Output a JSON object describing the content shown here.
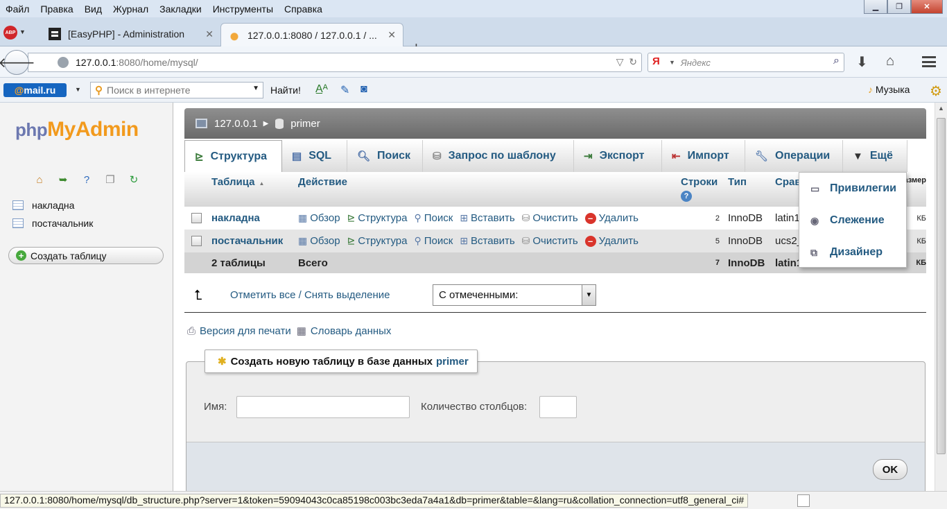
{
  "menubar": {
    "items": [
      "Файл",
      "Правка",
      "Вид",
      "Журнал",
      "Закладки",
      "Инструменты",
      "Справка"
    ],
    "window_controls": [
      "minimize-icon",
      "restore-icon",
      "close-icon"
    ]
  },
  "tabs": [
    {
      "title": "[EasyPHP] - Administration",
      "favicon": "easyphp-icon"
    },
    {
      "title": "127.0.0.1:8080 / 127.0.0.1 / ...",
      "favicon": "phpmyadmin-icon"
    }
  ],
  "navbar": {
    "url_host": "127.0.0.1",
    "url_rest": ":8080/home/mysql/",
    "search_placeholder": "Яндекс",
    "search_engine_glyph": "Я"
  },
  "mailbar": {
    "logo_at": "@",
    "logo_text": "mail.ru",
    "search_placeholder": "Поиск в интернете",
    "find_label": "Найти!",
    "music_label": "Музыка"
  },
  "sidebar": {
    "logo_php": "php",
    "logo_my": "My",
    "logo_admin": "Admin",
    "tables": [
      "накладна",
      "постачальник"
    ],
    "create_table": "Создать таблицу"
  },
  "main": {
    "breadcrumb": {
      "server": "127.0.0.1",
      "database": "primer"
    },
    "tabs": [
      {
        "label": "Структура",
        "icon": "structure-icon",
        "active": true
      },
      {
        "label": "SQL",
        "icon": "sql-icon",
        "active": false
      },
      {
        "label": "Поиск",
        "icon": "search-icon",
        "active": false
      },
      {
        "label": "Запрос по шаблону",
        "icon": "query-icon",
        "active": false
      },
      {
        "label": "Экспорт",
        "icon": "export-icon",
        "active": false
      },
      {
        "label": "Импорт",
        "icon": "import-icon",
        "active": false
      },
      {
        "label": "Операции",
        "icon": "wrench-icon",
        "active": false
      },
      {
        "label": "Ещё",
        "icon": "chevron-down-icon",
        "active": false
      }
    ],
    "more_menu": [
      "Привилегии",
      "Слежение",
      "Дизайнер"
    ],
    "table": {
      "headers": {
        "table": "Таблица",
        "action": "Действие",
        "rows": "Строки",
        "type": "Тип",
        "collation": "Сравнение",
        "size": "Размер"
      },
      "actions": [
        "Обзор",
        "Структура",
        "Поиск",
        "Вставить",
        "Очистить",
        "Удалить"
      ],
      "rows": [
        {
          "name": "накладна",
          "rows": "2",
          "type": "InnoDB",
          "collation": "latin1_swedish_ci",
          "size": "КБ"
        },
        {
          "name": "постачальник",
          "rows": "5",
          "type": "InnoDB",
          "collation": "ucs2_general_ci",
          "size": "КБ"
        }
      ],
      "total": {
        "label": "2 таблицы",
        "action": "Всего",
        "rows": "7",
        "type": "InnoDB",
        "collation": "latin1_swedish_ci",
        "size": "КБ"
      }
    },
    "check_all": "Отметить все / Снять выделение",
    "with_selected": "С отмеченными:",
    "print_view": "Версия для печати",
    "data_dictionary": "Словарь данных",
    "create_new": {
      "legend": "Создать новую таблицу в базе данных",
      "dbname": "primer",
      "name_label": "Имя:",
      "name_value": "",
      "columns_label": "Количество столбцов:",
      "columns_value": "",
      "ok_label": "OK"
    }
  },
  "statusbar": {
    "text": "127.0.0.1:8080/home/mysql/db_structure.php?server=1&token=59094043c0ca85198c003bc3eda7a4a1&db=primer&table=&lang=ru&collation_connection=utf8_general_ci#"
  }
}
